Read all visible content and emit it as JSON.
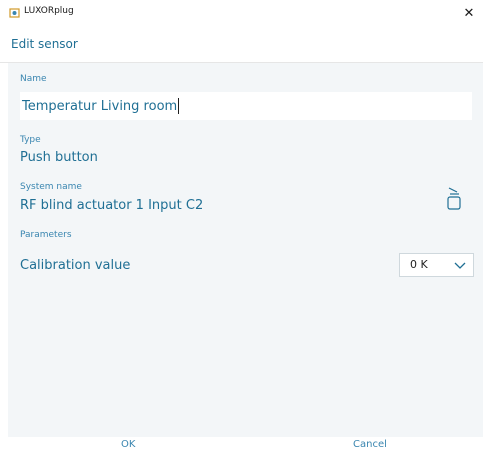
{
  "window": {
    "app_title": "LUXORplug",
    "close_glyph": "✕"
  },
  "header": {
    "title": "Edit sensor"
  },
  "form": {
    "name_label": "Name",
    "name_value": "Temperatur Living room",
    "type_label": "Type",
    "type_value": "Push button",
    "system_name_label": "System name",
    "system_name_value": "RF blind actuator 1 Input C2",
    "parameters_label": "Parameters",
    "calibration_label": "Calibration value",
    "calibration_selected": "0 K"
  },
  "footer": {
    "ok_label": "OK",
    "cancel_label": "Cancel"
  },
  "icons": {
    "app": "app-logo-icon",
    "identify": "bell-identify-icon",
    "dropdown": "chevron-down-icon"
  },
  "colors": {
    "accent": "#1f6f94",
    "label": "#3a86b0",
    "panel_bg": "#f3f6f8"
  }
}
